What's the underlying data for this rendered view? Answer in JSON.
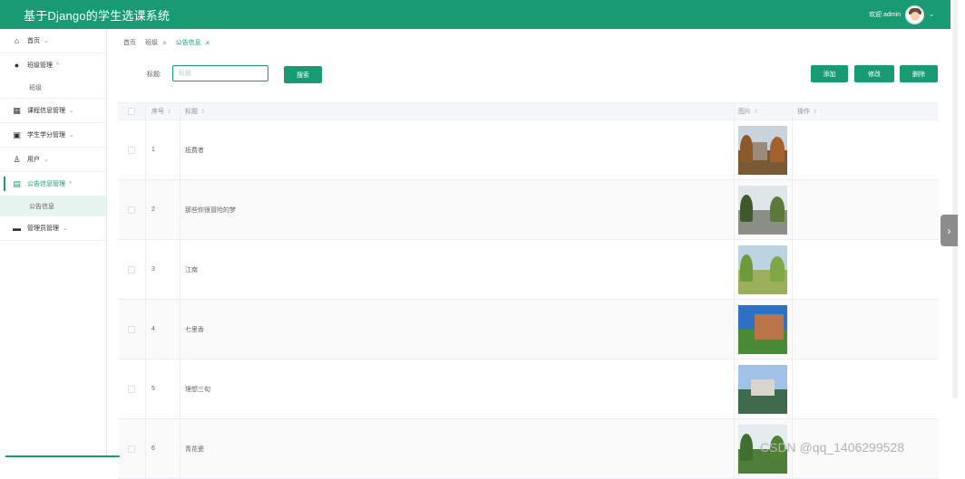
{
  "app": {
    "title": "基于Django的学生选课系统"
  },
  "header": {
    "welcome": "欢迎 admin",
    "dropdown_caret": "⌄"
  },
  "sidebar": {
    "items": [
      {
        "label": "首页",
        "icon": "home-icon",
        "arrow": "⌄"
      },
      {
        "label": "班级管理",
        "icon": "class-icon",
        "arrow": "^"
      },
      {
        "label": "班级",
        "sub": true
      },
      {
        "label": "课程信息管理",
        "icon": "grid-icon",
        "arrow": "⌄"
      },
      {
        "label": "学生学分管理",
        "icon": "book-icon",
        "arrow": "⌄"
      },
      {
        "label": "用户",
        "icon": "user-icon",
        "arrow": "⌄"
      },
      {
        "label": "公告信息管理",
        "icon": "notice-icon",
        "arrow": "^"
      },
      {
        "label": "公告信息",
        "sub": true
      },
      {
        "label": "管理员管理",
        "icon": "admin-icon",
        "arrow": "⌄"
      }
    ]
  },
  "tabs": [
    {
      "label": "首页"
    },
    {
      "label": "班级",
      "close": "×"
    },
    {
      "label": "公告信息",
      "close": "×"
    }
  ],
  "search": {
    "label": "标题:",
    "placeholder": "标题",
    "button": "搜索"
  },
  "toolbar": {
    "add": "添加",
    "edit": "修改",
    "delete": "删除"
  },
  "table": {
    "headers": {
      "index": "序号",
      "title": "标题",
      "image": "图片",
      "actions": "操作",
      "sort": "⇕"
    },
    "rows": [
      {
        "index": "1",
        "title": "抵费者"
      },
      {
        "index": "2",
        "title": "那些你很冒险的梦"
      },
      {
        "index": "3",
        "title": "江南"
      },
      {
        "index": "4",
        "title": "七里香"
      },
      {
        "index": "5",
        "title": "理想三旬"
      },
      {
        "index": "6",
        "title": "青花瓷"
      }
    ]
  },
  "watermark": "CSDN @qq_1406299528",
  "colors": {
    "primary": "#189b73"
  }
}
